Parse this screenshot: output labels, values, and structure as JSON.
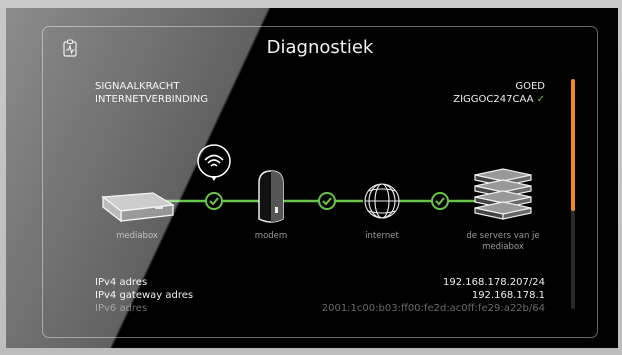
{
  "header": {
    "title": "Diagnostiek",
    "icon": "clipboard-pulse-icon"
  },
  "status": {
    "signal_label": "SIGNAALKRACHT",
    "signal_value": "GOED",
    "internet_label": "INTERNETVERBINDING",
    "internet_value": "ZIGGOC247CAA",
    "check_glyph": "✓"
  },
  "devices": [
    {
      "label": "mediabox",
      "icon": "mediabox-icon"
    },
    {
      "label": "modem",
      "icon": "modem-icon"
    },
    {
      "label": "internet",
      "icon": "globe-icon"
    },
    {
      "label": "de servers van je mediabox",
      "icon": "server-stack-icon"
    }
  ],
  "network": {
    "ipv4_label": "IPv4 adres",
    "ipv4_value": "192.168.178.207/24",
    "gateway_label": "IPv4 gateway adres",
    "gateway_value": "192.168.178.1",
    "ipv6_label": "IPv6 adres",
    "ipv6_value": "2001:1c00:b03:ff00:fe2d:ac0ff:fe29:a22b/64"
  },
  "colors": {
    "accent": "#f08a1e",
    "ok": "#67c54a",
    "text": "#f0f0f0",
    "muted": "#9a9a9a"
  }
}
